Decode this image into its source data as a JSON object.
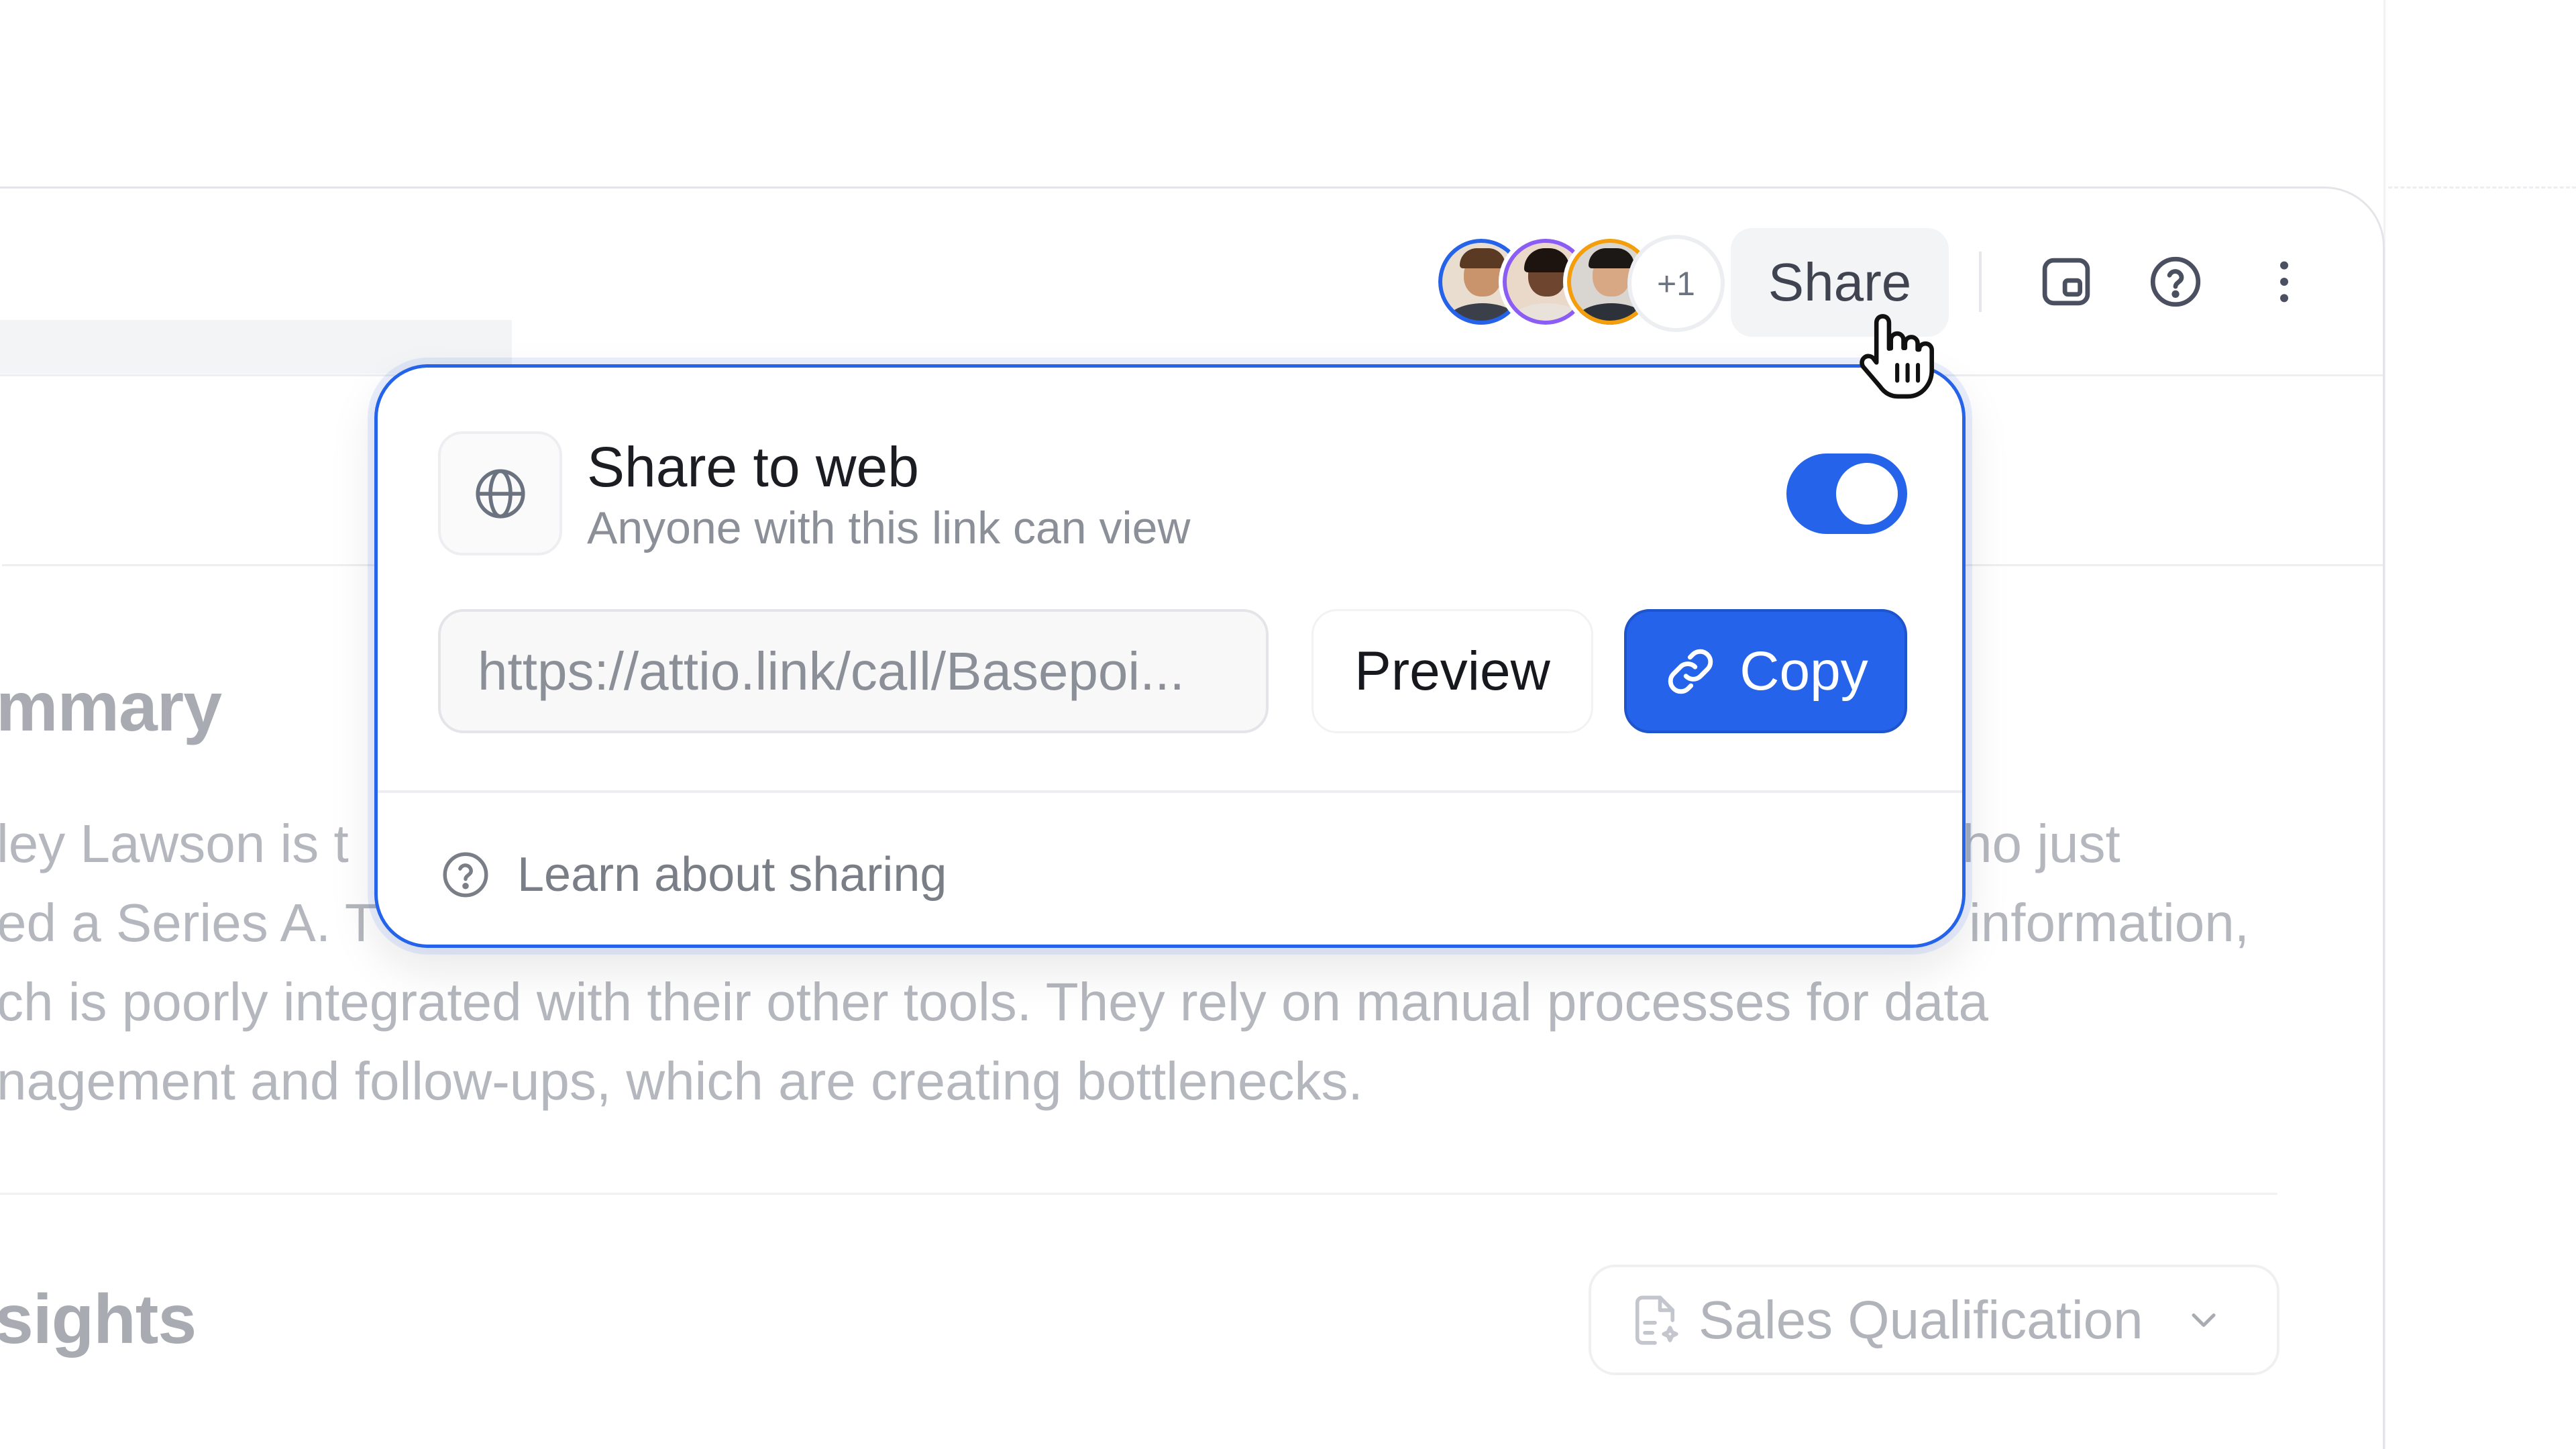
{
  "header": {
    "avatars": [
      {
        "name": "avatar-1",
        "ring_color": "#2563eb"
      },
      {
        "name": "avatar-2",
        "ring_color": "#8b5cf6"
      },
      {
        "name": "avatar-3",
        "ring_color": "#f59e0b"
      }
    ],
    "avatar_overflow": "+1",
    "share_label": "Share",
    "icons": [
      "picture-in-picture-icon",
      "help-icon",
      "more-vertical-icon"
    ]
  },
  "background": {
    "summary_heading": "mmary",
    "summary_lines": [
      "ley Lawson is t",
      "ed a Series A. T",
      "ch is poorly integrated with their other tools. They rely on manual processes for data",
      "nagement and follow-ups, which are creating bottlenecks."
    ],
    "summary_right_fragments": [
      "ho just",
      "information,"
    ],
    "insights_heading": "sights",
    "template_select": "Sales Qualification"
  },
  "popover": {
    "title": "Share to web",
    "subtitle": "Anyone with this link can view",
    "toggle_on": true,
    "url": "https://attio.link/call/Basepoi...",
    "preview_label": "Preview",
    "copy_label": "Copy",
    "learn_label": "Learn about sharing",
    "accent": "#2563eb"
  }
}
